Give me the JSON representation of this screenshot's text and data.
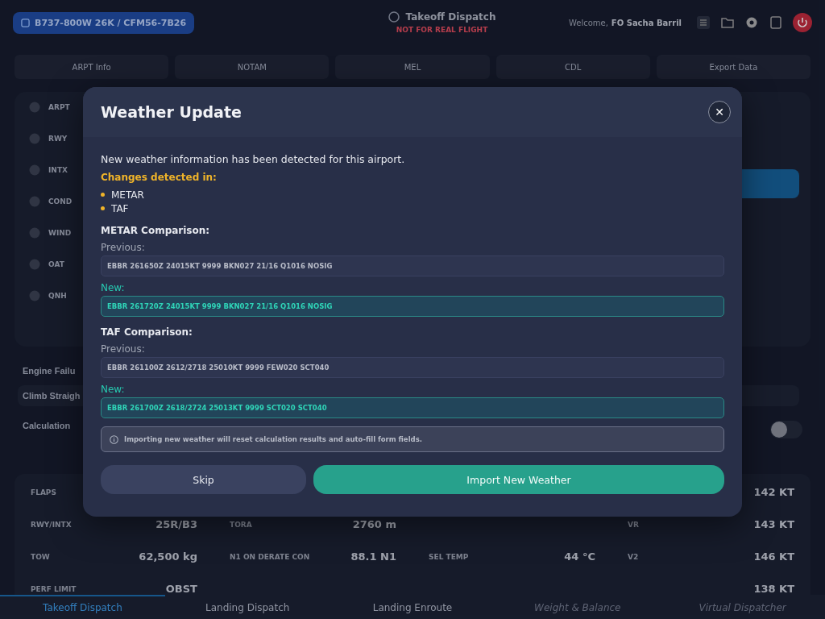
{
  "header": {
    "aircraft": "B737-800W 26K / CFM56-7B26",
    "title": "Takeoff Dispatch",
    "subtitle": "NOT FOR REAL FLIGHT",
    "welcome": "Welcome,",
    "user": "FO Sacha Barril"
  },
  "tabs": [
    {
      "label": "ARPT Info"
    },
    {
      "label": "NOTAM"
    },
    {
      "label": "MEL"
    },
    {
      "label": "CDL"
    },
    {
      "label": "Export Data"
    }
  ],
  "inputs": [
    {
      "label": "ARPT"
    },
    {
      "label": "RWY"
    },
    {
      "label": "INTX"
    },
    {
      "label": "COND"
    },
    {
      "label": "WIND"
    },
    {
      "label": "OAT"
    },
    {
      "label": "QNH"
    }
  ],
  "engine_failure": {
    "title": "Engine Failu",
    "procedure": "Climb Straigh"
  },
  "calculation": {
    "title": "Calculation",
    "toggle_on": false
  },
  "results": [
    {
      "column_1": {
        "label": "FLAPS"
      },
      "column_4": {
        "value": "142 KT"
      }
    },
    {
      "column_1": {
        "label": "RWY/INTX",
        "value": "25R/B3"
      },
      "column_2": {
        "label": "TORA",
        "value": "2760 m"
      },
      "column_4": {
        "label": "VR",
        "value": "143 KT"
      }
    },
    {
      "column_1": {
        "label": "TOW",
        "value": "62,500 kg"
      },
      "column_2": {
        "label": "N1 ON DERATE CON",
        "value": "88.1 N1"
      },
      "column_3": {
        "label": "SEL TEMP",
        "value": "44 °C"
      },
      "column_4": {
        "label": "V2",
        "value": "146 KT"
      }
    },
    {
      "column_1": {
        "label": "PERF LIMIT",
        "value": "OBST"
      },
      "column_4": {
        "value": "138 KT"
      }
    }
  ],
  "bottom_nav": [
    {
      "label": "Takeoff Dispatch",
      "selected": true,
      "disabled": false
    },
    {
      "label": "Landing Dispatch",
      "selected": false,
      "disabled": false
    },
    {
      "label": "Landing Enroute",
      "selected": false,
      "disabled": false
    },
    {
      "label": "Weight & Balance",
      "selected": false,
      "disabled": true
    },
    {
      "label": "Virtual Dispatcher",
      "selected": false,
      "disabled": true
    }
  ],
  "dialog": {
    "title": "Weather Update",
    "close": "✕",
    "message": "New weather information has been detected for this airport.",
    "changes_title": "Changes detected in:",
    "changes": [
      "METAR",
      "TAF"
    ],
    "comparisons": [
      {
        "title": "METAR Comparison:",
        "previous_label": "Previous:",
        "previous": "EBBR 261650Z 24015KT 9999 BKN027 21/16 Q1016 NOSIG",
        "new_label": "New:",
        "new": "EBBR 261720Z 24015KT 9999 BKN027 21/16 Q1016 NOSIG"
      },
      {
        "title": "TAF Comparison:",
        "previous_label": "Previous:",
        "previous": "EBBR 261100Z 2612/2718 25010KT 9999 FEW020 SCT040",
        "new_label": "New:",
        "new": "EBBR 261700Z 2618/2724 25013KT 9999 SCT020 SCT040"
      }
    ],
    "notice": "Importing new weather will reset calculation results and auto-fill form fields.",
    "buttons": [
      {
        "kind": "secondary",
        "label": "Skip"
      },
      {
        "kind": "primary",
        "label": "Import New Weather"
      }
    ]
  }
}
